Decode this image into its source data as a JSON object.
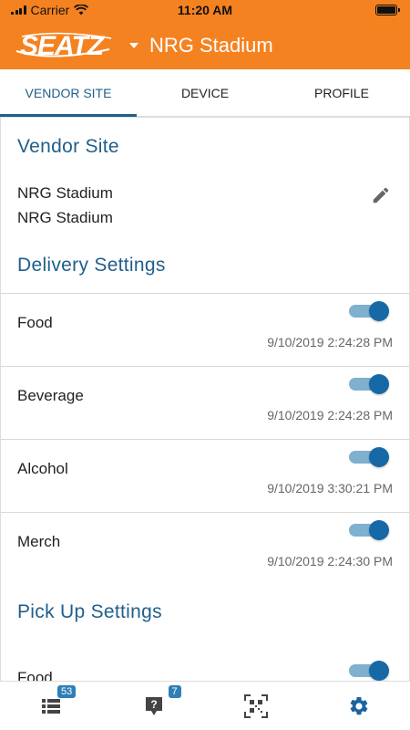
{
  "status_bar": {
    "carrier": "Carrier",
    "time": "11:20 AM"
  },
  "header": {
    "logo_text": "SEATZ",
    "venue": "NRG Stadium"
  },
  "tabs": [
    {
      "label": "VENDOR SITE",
      "active": true
    },
    {
      "label": "DEVICE",
      "active": false
    },
    {
      "label": "PROFILE",
      "active": false
    }
  ],
  "vendor_site": {
    "title": "Vendor Site",
    "line1": "NRG Stadium",
    "line2": "NRG Stadium"
  },
  "delivery_settings": {
    "title": "Delivery Settings",
    "items": [
      {
        "label": "Food",
        "timestamp": "9/10/2019 2:24:28 PM",
        "enabled": true
      },
      {
        "label": "Beverage",
        "timestamp": "9/10/2019 2:24:28 PM",
        "enabled": true
      },
      {
        "label": "Alcohol",
        "timestamp": "9/10/2019 3:30:21 PM",
        "enabled": true
      },
      {
        "label": "Merch",
        "timestamp": "9/10/2019 2:24:30 PM",
        "enabled": true
      }
    ]
  },
  "pickup_settings": {
    "title": "Pick Up Settings",
    "items": [
      {
        "label": "Food",
        "enabled": true
      }
    ]
  },
  "bottom_nav": {
    "orders_badge": "53",
    "help_badge": "7"
  },
  "colors": {
    "brand_orange": "#f58220",
    "accent_blue": "#1f5f8b",
    "toggle_on": "#1669a6"
  }
}
